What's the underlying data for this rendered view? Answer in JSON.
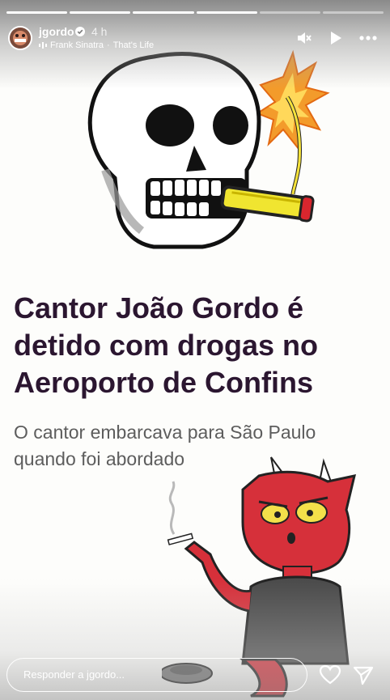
{
  "story": {
    "progress": {
      "total": 6,
      "viewed": 4
    },
    "user": {
      "username": "jgordo",
      "verified": true,
      "time": "4 h"
    },
    "music": {
      "artist": "Frank Sinatra",
      "separator": "·",
      "song": "That's Life"
    },
    "controls": {
      "mute_icon": "speaker-muted-icon",
      "play_icon": "play-icon",
      "more_icon": "more-horizontal-icon"
    },
    "post": {
      "headline": "Cantor João Gordo é detido com drogas no Aeroporto de Confins",
      "subheadline": "O cantor embarcava para São Paulo quando foi abordado"
    },
    "reply": {
      "placeholder": "Responder a jgordo..."
    },
    "actions": {
      "like_icon": "heart-icon",
      "share_icon": "send-icon"
    },
    "colors": {
      "headline": "#2b1630",
      "subheadline": "#5d5d5d",
      "devil": "#d6303a",
      "background": "#fdfdfb"
    }
  }
}
